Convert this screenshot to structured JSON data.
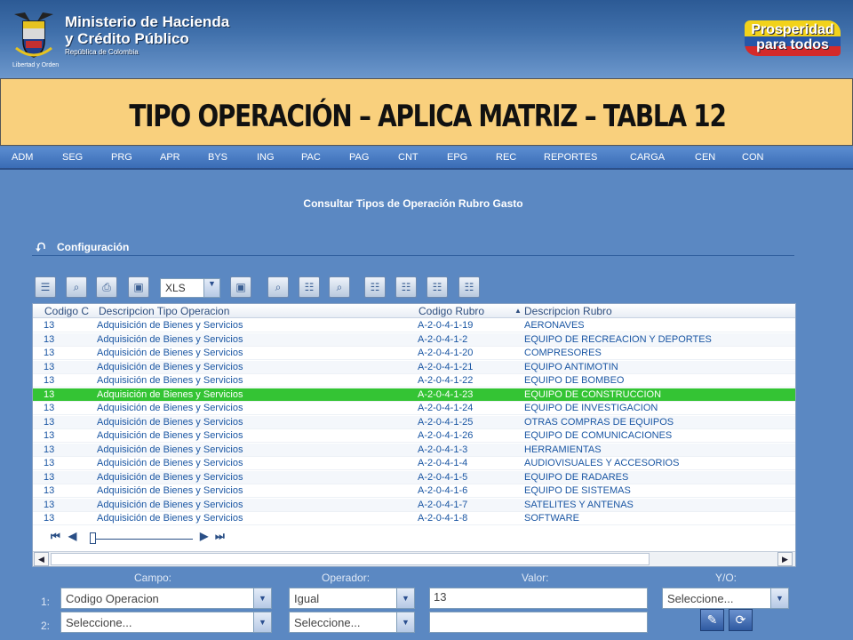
{
  "header": {
    "ministry_line1": "Ministerio de Hacienda",
    "ministry_line2": "y Crédito Público",
    "republica": "República de Colombia",
    "crest_motto": "Libertad y Orden",
    "slogan_line1": "Prosperidad",
    "slogan_line2": "para todos"
  },
  "slide_title": "TIPO OPERACIÓN – APLICA MATRIZ – TABLA 12",
  "menu": [
    "ADM",
    "SEG",
    "PRG",
    "APR",
    "BYS",
    "ING",
    "PAC",
    "PAG",
    "CNT",
    "EPG",
    "REC",
    "REPORTES",
    "CARGA",
    "CEN",
    "CON"
  ],
  "form": {
    "title": "Consultar Tipos de Operación Rubro Gasto",
    "section_title": "Configuración"
  },
  "toolbar": {
    "format_selected": "XLS"
  },
  "grid": {
    "columns": [
      "Codigo C",
      "Descripcion Tipo Operacion",
      "Codigo Rubro",
      "Descripcion Rubro"
    ],
    "sort_column_index": 3,
    "selected_row_index": 5,
    "rows": [
      [
        "13",
        "Adquisición de Bienes y Servicios",
        "A-2-0-4-1-19",
        "AERONAVES"
      ],
      [
        "13",
        "Adquisición de Bienes y Servicios",
        "A-2-0-4-1-2",
        "EQUIPO DE RECREACION Y DEPORTES"
      ],
      [
        "13",
        "Adquisición de Bienes y Servicios",
        "A-2-0-4-1-20",
        "COMPRESORES"
      ],
      [
        "13",
        "Adquisición de Bienes y Servicios",
        "A-2-0-4-1-21",
        "EQUIPO ANTIMOTIN"
      ],
      [
        "13",
        "Adquisición de Bienes y Servicios",
        "A-2-0-4-1-22",
        "EQUIPO DE BOMBEO"
      ],
      [
        "13",
        "Adquisición de Bienes y Servicios",
        "A-2-0-4-1-23",
        "EQUIPO DE CONSTRUCCION"
      ],
      [
        "13",
        "Adquisición de Bienes y Servicios",
        "A-2-0-4-1-24",
        "EQUIPO DE INVESTIGACION"
      ],
      [
        "13",
        "Adquisición de Bienes y Servicios",
        "A-2-0-4-1-25",
        "OTRAS COMPRAS DE EQUIPOS"
      ],
      [
        "13",
        "Adquisición de Bienes y Servicios",
        "A-2-0-4-1-26",
        "EQUIPO DE COMUNICACIONES"
      ],
      [
        "13",
        "Adquisición de Bienes y Servicios",
        "A-2-0-4-1-3",
        "HERRAMIENTAS"
      ],
      [
        "13",
        "Adquisición de Bienes y Servicios",
        "A-2-0-4-1-4",
        "AUDIOVISUALES Y ACCESORIOS"
      ],
      [
        "13",
        "Adquisición de Bienes y Servicios",
        "A-2-0-4-1-5",
        "EQUIPO DE RADARES"
      ],
      [
        "13",
        "Adquisición de Bienes y Servicios",
        "A-2-0-4-1-6",
        "EQUIPO DE SISTEMAS"
      ],
      [
        "13",
        "Adquisición de Bienes y Servicios",
        "A-2-0-4-1-7",
        "SATELITES Y ANTENAS"
      ],
      [
        "13",
        "Adquisición de Bienes y Servicios",
        "A-2-0-4-1-8",
        "SOFTWARE"
      ]
    ]
  },
  "filter": {
    "labels": {
      "campo": "Campo:",
      "operador": "Operador:",
      "valor": "Valor:",
      "yo": "Y/O:"
    },
    "rows": [
      {
        "num": "1:",
        "campo": "Codigo Operacion",
        "operador": "Igual",
        "valor": "13",
        "yo": "Seleccione..."
      },
      {
        "num": "2:",
        "campo": "Seleccione...",
        "operador": "Seleccione...",
        "valor": ""
      }
    ]
  }
}
